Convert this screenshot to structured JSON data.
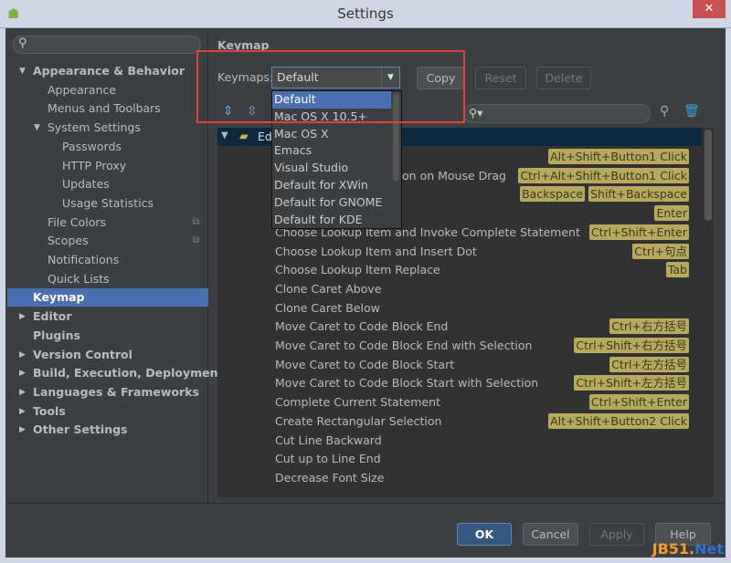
{
  "window": {
    "title": "Settings",
    "close": "✕"
  },
  "sidebar": {
    "items": [
      {
        "label": "Appearance & Behavior",
        "level": 0,
        "bold": true,
        "arrow": "▼"
      },
      {
        "label": "Appearance",
        "level": 1
      },
      {
        "label": "Menus and Toolbars",
        "level": 1
      },
      {
        "label": "System Settings",
        "level": 1,
        "arrow": "▼"
      },
      {
        "label": "Passwords",
        "level": 2
      },
      {
        "label": "HTTP Proxy",
        "level": 2
      },
      {
        "label": "Updates",
        "level": 2
      },
      {
        "label": "Usage Statistics",
        "level": 2
      },
      {
        "label": "File Colors",
        "level": 1,
        "copy": true
      },
      {
        "label": "Scopes",
        "level": 1,
        "copy": true
      },
      {
        "label": "Notifications",
        "level": 1
      },
      {
        "label": "Quick Lists",
        "level": 1
      },
      {
        "label": "Keymap",
        "level": 0,
        "bold": true,
        "selected": true
      },
      {
        "label": "Editor",
        "level": 0,
        "bold": true,
        "arrow": "▶"
      },
      {
        "label": "Plugins",
        "level": 0,
        "bold": true
      },
      {
        "label": "Version Control",
        "level": 0,
        "bold": true,
        "arrow": "▶"
      },
      {
        "label": "Build, Execution, Deployment",
        "level": 0,
        "bold": true,
        "arrow": "▶"
      },
      {
        "label": "Languages & Frameworks",
        "level": 0,
        "bold": true,
        "arrow": "▶"
      },
      {
        "label": "Tools",
        "level": 0,
        "bold": true,
        "arrow": "▶"
      },
      {
        "label": "Other Settings",
        "level": 0,
        "bold": true,
        "arrow": "▶"
      }
    ]
  },
  "main": {
    "heading": "Keymap",
    "keymaps_label": "Keymaps:",
    "keymap_value": "Default",
    "copy": "Copy",
    "reset": "Reset",
    "delete": "Delete",
    "dropdown": [
      "Default",
      "Mac OS X 10.5+",
      "Mac OS X",
      "Emacs",
      "Visual Studio",
      "Default for XWin",
      "Default for GNOME",
      "Default for KDE"
    ],
    "group": "Ed",
    "actions": [
      {
        "text": "",
        "keys": [
          "Alt+Shift+Button1 Click"
        ]
      },
      {
        "text": "on on Mouse Drag",
        "offset": true,
        "keys": [
          "Ctrl+Alt+Shift+Button1 Click"
        ]
      },
      {
        "text": "",
        "keys": [
          "Backspace",
          "Shift+Backspace"
        ]
      },
      {
        "text": "",
        "keys": [
          "Enter"
        ]
      },
      {
        "text": "Choose Lookup Item and Invoke Complete Statement",
        "keys": [
          "Ctrl+Shift+Enter"
        ]
      },
      {
        "text": "Choose Lookup Item and Insert Dot",
        "keys": [
          "Ctrl+句点"
        ]
      },
      {
        "text": "Choose Lookup Item Replace",
        "keys": [
          "Tab"
        ]
      },
      {
        "text": "Clone Caret Above",
        "keys": []
      },
      {
        "text": "Clone Caret Below",
        "keys": []
      },
      {
        "text": "Move Caret to Code Block End",
        "keys": [
          "Ctrl+右方括号"
        ]
      },
      {
        "text": "Move Caret to Code Block End with Selection",
        "keys": [
          "Ctrl+Shift+右方括号"
        ]
      },
      {
        "text": "Move Caret to Code Block Start",
        "keys": [
          "Ctrl+左方括号"
        ]
      },
      {
        "text": "Move Caret to Code Block Start with Selection",
        "keys": [
          "Ctrl+Shift+左方括号"
        ]
      },
      {
        "text": "Complete Current Statement",
        "keys": [
          "Ctrl+Shift+Enter"
        ]
      },
      {
        "text": "Create Rectangular Selection",
        "keys": [
          "Alt+Shift+Button2 Click"
        ]
      },
      {
        "text": "Cut Line Backward",
        "keys": []
      },
      {
        "text": "Cut up to Line End",
        "keys": []
      },
      {
        "text": "Decrease Font Size",
        "keys": []
      }
    ]
  },
  "footer": {
    "ok": "OK",
    "cancel": "Cancel",
    "apply": "Apply",
    "help": "Help"
  },
  "watermark": {
    "a": "JB51.",
    "b": "Net"
  }
}
